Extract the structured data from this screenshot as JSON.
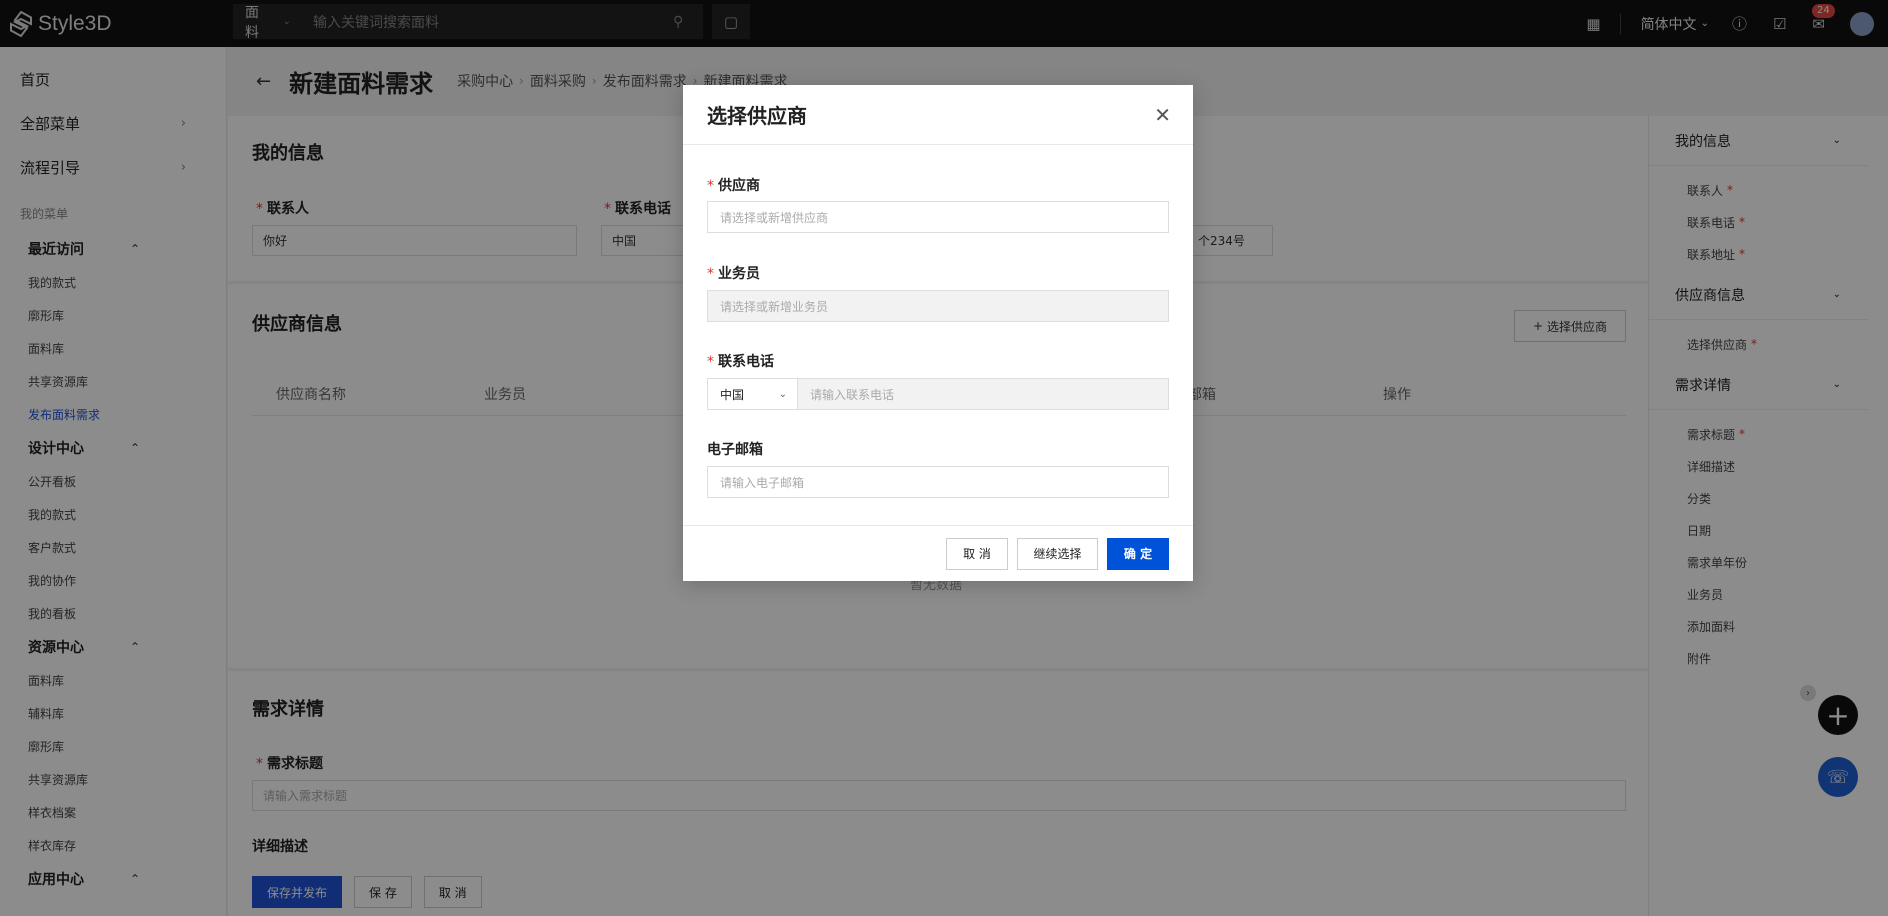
{
  "topbar": {
    "logo_text": "Style3D",
    "search_category": "面料",
    "search_placeholder": "输入关键词搜索面料",
    "language": "简体中文",
    "notification_count": "24"
  },
  "sidebar": {
    "top_items": [
      {
        "label": "首页"
      },
      {
        "label": "全部菜单"
      },
      {
        "label": "流程引导"
      }
    ],
    "section_caption": "我的菜单",
    "groups": [
      {
        "label": "最近访问",
        "items": [
          "我的款式",
          "廓形库",
          "面料库",
          "共享资源库",
          "发布面料需求"
        ]
      },
      {
        "label": "设计中心",
        "items": [
          "公开看板",
          "我的款式",
          "客户款式",
          "我的协作",
          "我的看板"
        ]
      },
      {
        "label": "资源中心",
        "items": [
          "面料库",
          "辅料库",
          "廓形库",
          "共享资源库",
          "样衣档案",
          "样衣库存"
        ]
      },
      {
        "label": "应用中心",
        "items": []
      }
    ]
  },
  "header": {
    "title": "新建面料需求",
    "breadcrumb": [
      "采购中心",
      "面料采购",
      "发布面料需求",
      "新建面料需求"
    ]
  },
  "my_info": {
    "title": "我的信息",
    "contact_label": "联系人",
    "contact_value": "你好",
    "phone_label": "联系电话",
    "phone_region": "中国",
    "address_partial": "个234号"
  },
  "supplier_info": {
    "title": "供应商信息",
    "select_button": "选择供应商",
    "columns": [
      "供应商名称",
      "业务员",
      "部箱",
      "操作"
    ],
    "empty_text": "暂无数据"
  },
  "demand": {
    "title": "需求详情",
    "title_label": "需求标题",
    "title_placeholder": "请输入需求标题",
    "desc_label": "详细描述"
  },
  "footer": {
    "publish": "保存并发布",
    "save": "保 存",
    "cancel": "取 消"
  },
  "anchor": {
    "sections": [
      {
        "label": "我的信息",
        "items": [
          {
            "label": "联系人",
            "req": true
          },
          {
            "label": "联系电话",
            "req": true
          },
          {
            "label": "联系地址",
            "req": true
          }
        ]
      },
      {
        "label": "供应商信息",
        "items": [
          {
            "label": "选择供应商",
            "req": true
          }
        ]
      },
      {
        "label": "需求详情",
        "items": [
          {
            "label": "需求标题",
            "req": true
          },
          {
            "label": "详细描述"
          },
          {
            "label": "分类"
          },
          {
            "label": "日期"
          },
          {
            "label": "需求单年份"
          },
          {
            "label": "业务员"
          },
          {
            "label": "添加面料"
          },
          {
            "label": "附件"
          }
        ]
      }
    ]
  },
  "modal": {
    "title": "选择供应商",
    "supplier_label": "供应商",
    "supplier_placeholder": "请选择或新增供应商",
    "salesperson_label": "业务员",
    "salesperson_placeholder": "请选择或新增业务员",
    "phone_label": "联系电话",
    "phone_region": "中国",
    "phone_placeholder": "请输入联系电话",
    "email_label": "电子邮箱",
    "email_placeholder": "请输入电子邮箱",
    "cancel": "取 消",
    "continue": "继续选择",
    "confirm": "确 定"
  }
}
